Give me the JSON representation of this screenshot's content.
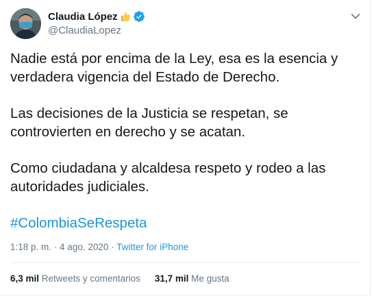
{
  "author": {
    "display_name": "Claudia López",
    "handle": "@ClaudiaLopez",
    "emoji_icon": "thumbs-up-icon",
    "verified_icon": "verified-badge-icon"
  },
  "tweet": {
    "paragraphs": [
      "Nadie está por encima de la Ley, esa es la esencia y verdadera vigencia del Estado de Derecho.",
      "Las decisiones de la Justicia se respetan, se controvierten en derecho y se acatan.",
      "Como ciudadana y alcaldesa respeto y rodeo a las autoridades judiciales."
    ],
    "hashtag": "#ColombiaSeRespeta"
  },
  "meta": {
    "time": "1:18 p. m.",
    "separator": " · ",
    "date": "4 ago. 2020",
    "source": "Twitter for iPhone"
  },
  "stats": {
    "retweets_count": "6,3 mil",
    "retweets_label": "Retweets y comentarios",
    "likes_count": "31,7 mil",
    "likes_label": "Me gusta"
  },
  "colors": {
    "link": "#1b95e0",
    "secondary_text": "#657786",
    "primary_text": "#14171a",
    "border": "#e6ecf0"
  }
}
